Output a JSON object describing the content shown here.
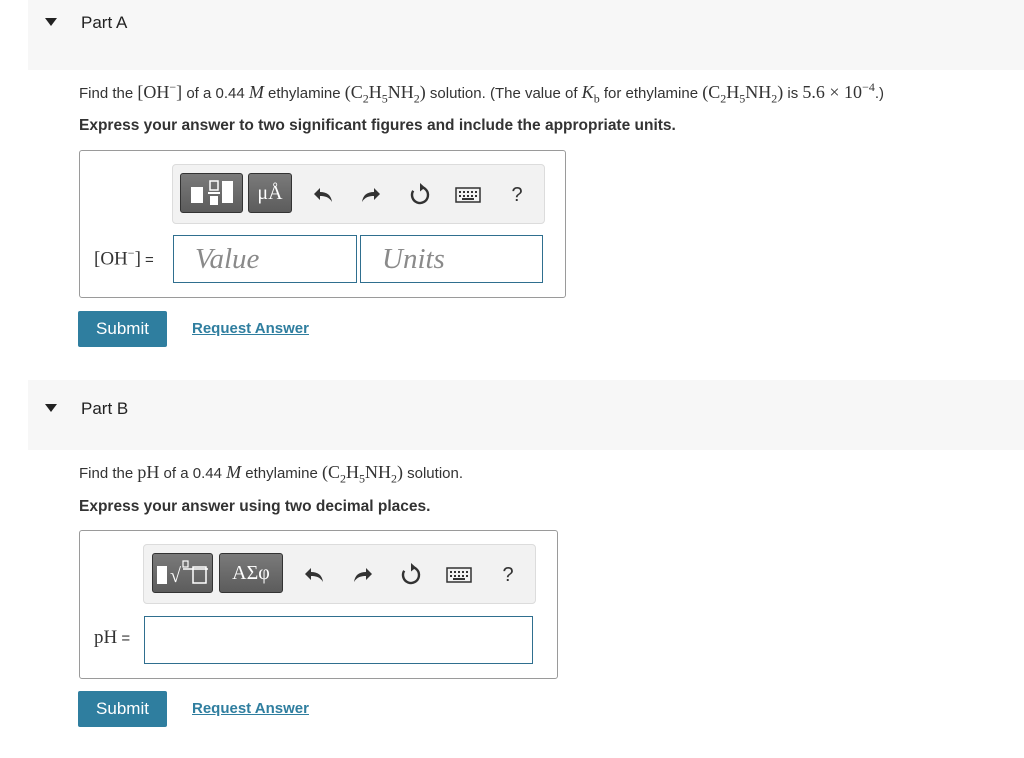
{
  "part_a": {
    "title": "Part A",
    "question": {
      "t1": "Find the ",
      "m1": "[OH",
      "m1_sup": "−",
      "m1_close": "]",
      "t2": " of a 0.44 ",
      "unit_M": "M",
      "t3": "  ethylamine ",
      "formula_open": "(C",
      "formula_c2": "2",
      "formula_h": "H",
      "formula_h5": "5",
      "formula_nh": "NH",
      "formula_nh2": "2",
      "formula_close": ")",
      "t4": " solution. (The value of ",
      "k": "K",
      "k_sub": "b",
      "t5": " for ethylamine ",
      "t6": " is ",
      "kb_value": "5.6 × 10",
      "kb_exp": "−4",
      "t7": ".)"
    },
    "instruction": "Express your answer to two significant figures and include the appropriate units.",
    "label_base": "[OH",
    "label_sup": "−",
    "label_close": "]",
    "equals": " =",
    "value_placeholder": "Value",
    "units_placeholder": "Units",
    "toolbar": {
      "units_btn": "μÅ",
      "help": "?"
    },
    "submit": "Submit",
    "request_answer": "Request Answer"
  },
  "part_b": {
    "title": "Part B",
    "question": {
      "t1": "Find the ",
      "ph": "pH",
      "t2": " of a 0.44 ",
      "unit_M": "M",
      "t3": "  ethylamine ",
      "t4": " solution."
    },
    "instruction": "Express your answer using two decimal places.",
    "label": "pH",
    "equals": " =",
    "toolbar": {
      "greek_btn": "ΑΣφ",
      "help": "?"
    },
    "submit": "Submit",
    "request_answer": "Request Answer"
  },
  "colors": {
    "accent": "#2f7e9f",
    "header_bg": "#f7f7f7",
    "toolbar_bg": "#f2f2f2",
    "field_border": "#2f6f8f"
  },
  "icons": [
    "triangle-down-icon",
    "fraction-template-icon",
    "undo-icon",
    "redo-icon",
    "reset-icon",
    "keyboard-icon",
    "sqrt-template-icon"
  ]
}
